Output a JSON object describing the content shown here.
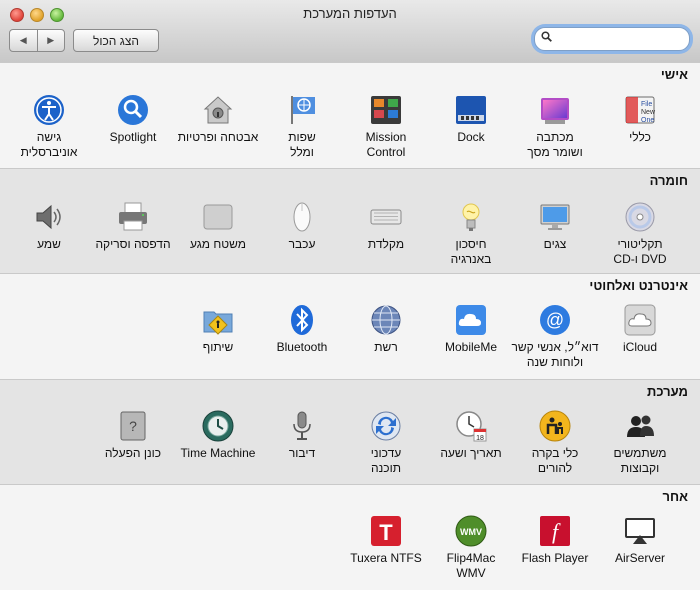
{
  "window": {
    "title": "העדפות המערכת"
  },
  "toolbar": {
    "back_label": "◀",
    "forward_label": "▶",
    "show_all_label": "הצג הכול",
    "search_value": ""
  },
  "sections": [
    {
      "title": "אישי",
      "items": [
        {
          "label": "כללי",
          "icon": "general-icon"
        },
        {
          "label": "מכתבה\nושומר מסך",
          "icon": "desktop-screensaver-icon"
        },
        {
          "label": "Dock",
          "icon": "dock-icon"
        },
        {
          "label": "Mission\nControl",
          "icon": "mission-control-icon"
        },
        {
          "label": "שפות\nומלל",
          "icon": "language-text-icon"
        },
        {
          "label": "אבטחה ופרטיות",
          "icon": "security-privacy-icon"
        },
        {
          "label": "Spotlight",
          "icon": "spotlight-icon"
        },
        {
          "label": "גישה\nאוניברסלית",
          "icon": "universal-access-icon"
        }
      ]
    },
    {
      "title": "חומרה",
      "items": [
        {
          "label": "תקליטורי\nDVD ו-CD",
          "icon": "cds-dvds-icon"
        },
        {
          "label": "צגים",
          "icon": "displays-icon"
        },
        {
          "label": "חיסכון\nבאנרגיה",
          "icon": "energy-saver-icon"
        },
        {
          "label": "מקלדת",
          "icon": "keyboard-icon"
        },
        {
          "label": "עכבר",
          "icon": "mouse-icon"
        },
        {
          "label": "משטח מגע",
          "icon": "trackpad-icon"
        },
        {
          "label": "הדפסה וסריקה",
          "icon": "print-scan-icon"
        },
        {
          "label": "שמע",
          "icon": "sound-icon"
        }
      ]
    },
    {
      "title": "אינטרנט ואלחוטי",
      "items": [
        {
          "label": "iCloud",
          "icon": "icloud-icon"
        },
        {
          "label": "דוא״ל, אנשי קשר\nולוחות שנה",
          "icon": "mail-contacts-calendars-icon"
        },
        {
          "label": "MobileMe",
          "icon": "mobileme-icon"
        },
        {
          "label": "רשת",
          "icon": "network-icon"
        },
        {
          "label": "Bluetooth",
          "icon": "bluetooth-icon"
        },
        {
          "label": "שיתוף",
          "icon": "sharing-icon"
        }
      ]
    },
    {
      "title": "מערכת",
      "items": [
        {
          "label": "משתמשים\nוקבוצות",
          "icon": "users-groups-icon"
        },
        {
          "label": "כלי בקרה\nלהורים",
          "icon": "parental-controls-icon"
        },
        {
          "label": "תאריך ושעה",
          "icon": "date-time-icon"
        },
        {
          "label": "עדכוני\nתוכנה",
          "icon": "software-update-icon"
        },
        {
          "label": "דיבור",
          "icon": "speech-icon"
        },
        {
          "label": "Time Machine",
          "icon": "time-machine-icon"
        },
        {
          "label": "כונן הפעלה",
          "icon": "startup-disk-icon"
        }
      ]
    },
    {
      "title": "אחר",
      "items": [
        {
          "label": "AirServer",
          "icon": "airserver-icon"
        },
        {
          "label": "Flash Player",
          "icon": "flash-player-icon"
        },
        {
          "label": "Flip4Mac\nWMV",
          "icon": "flip4mac-wmv-icon"
        },
        {
          "label": "Tuxera NTFS",
          "icon": "tuxera-ntfs-icon"
        }
      ]
    }
  ],
  "icon_texts": {
    "general_file": "File",
    "general_new": "New",
    "general_one": "One",
    "wmv": "WMV",
    "tuxera": "T",
    "flash": "f",
    "calendar_day": "18"
  }
}
